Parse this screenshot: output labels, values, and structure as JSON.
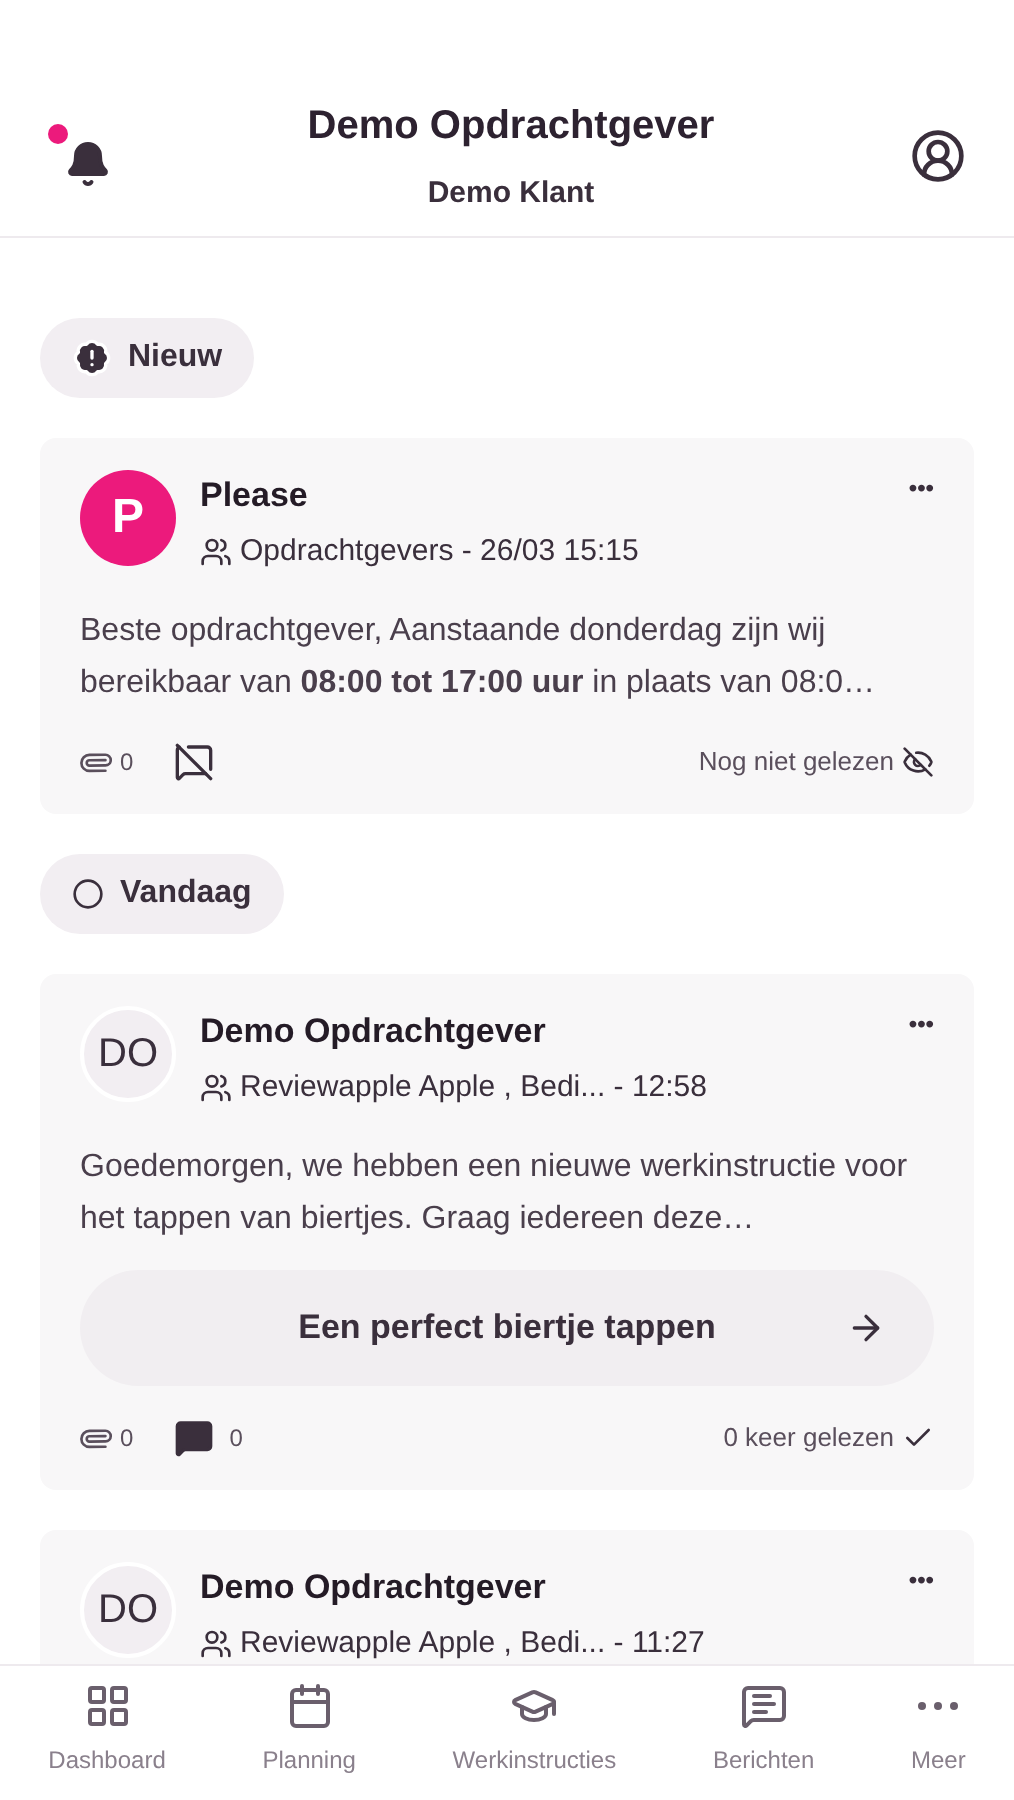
{
  "header": {
    "title": "Demo Opdrachtgever",
    "subtitle": "Demo Klant",
    "notification_dot": true
  },
  "sections": [
    {
      "label": "Nieuw",
      "kind": "new",
      "messages": [
        {
          "avatar": {
            "initials": "P",
            "color": "#ec1a7c"
          },
          "sender": "Please",
          "recipients": "Opdrachtgevers - 26/03 15:15",
          "menu": "•••",
          "body": "Beste opdrachtgever,  Aanstaande donderdag zijn wij bereikbaar van **08:00 tot 17:00 uur** in plaats van 08:0…",
          "attachments": "0",
          "comments_enabled": false,
          "read": false,
          "read_status": "Nog niet gelezen"
        }
      ]
    },
    {
      "label": "Vandaag",
      "kind": "today",
      "messages": [
        {
          "avatar": {
            "initials": "DO",
            "color": "#f2eef2"
          },
          "sender": "Demo Opdrachtgever",
          "recipients": "Reviewapple Apple , Bedi... - 12:58",
          "menu": "•••",
          "body": "Goedemorgen, we hebben een nieuwe werkinstructie voor het tappen van biertjes. Graag iedereen deze…",
          "link": "Een perfect biertje tappen",
          "attachments": "0",
          "comments_enabled": true,
          "comments": "0",
          "read": true,
          "read_status": "0 keer gelezen"
        },
        {
          "avatar": {
            "initials": "DO",
            "color": "#f2eef2"
          },
          "sender": "Demo Opdrachtgever",
          "recipients": "Reviewapple Apple , Bedi... - 11:27",
          "menu": "•••"
        }
      ]
    }
  ],
  "nav": [
    {
      "label": "Dashboard",
      "kind": "dashboard"
    },
    {
      "label": "Planning",
      "kind": "planning"
    },
    {
      "label": "Werkinstructies",
      "kind": "instructions"
    },
    {
      "label": "Berichten",
      "kind": "messages"
    },
    {
      "label": "Meer",
      "kind": "more"
    }
  ]
}
